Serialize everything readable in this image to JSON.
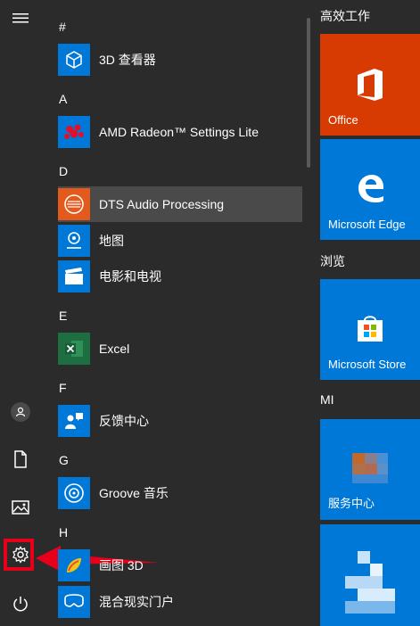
{
  "apps": [
    {
      "label": "3D 查看器"
    },
    {
      "label": "AMD Radeon™ Settings Lite"
    },
    {
      "label": "DTS Audio Processing"
    },
    {
      "label": "地图"
    },
    {
      "label": "电影和电视"
    },
    {
      "label": "Excel"
    },
    {
      "label": "反馈中心"
    },
    {
      "label": "Groove 音乐"
    },
    {
      "label": "画图 3D"
    },
    {
      "label": "混合现实门户"
    }
  ],
  "letters": [
    "#",
    "A",
    "D",
    "E",
    "F",
    "G",
    "H"
  ],
  "groups": [
    "高效工作",
    "浏览",
    "MI"
  ],
  "tiles": [
    {
      "label": "Office",
      "color": "#d83b01"
    },
    {
      "label": "Microsoft Edge",
      "color": "#0078d7"
    },
    {
      "label": "Microsoft Store",
      "color": "#0078d7"
    },
    {
      "label": "服务中心",
      "color": "#0078d7"
    },
    {
      "label": "",
      "color": "#0078d7"
    }
  ],
  "colors": {
    "accent": "#0078d7",
    "highlight": "#e8001a"
  },
  "icons": {
    "rail": [
      "hamburger-icon",
      "user-icon",
      "document-icon",
      "pictures-icon",
      "settings-icon",
      "power-icon"
    ]
  }
}
